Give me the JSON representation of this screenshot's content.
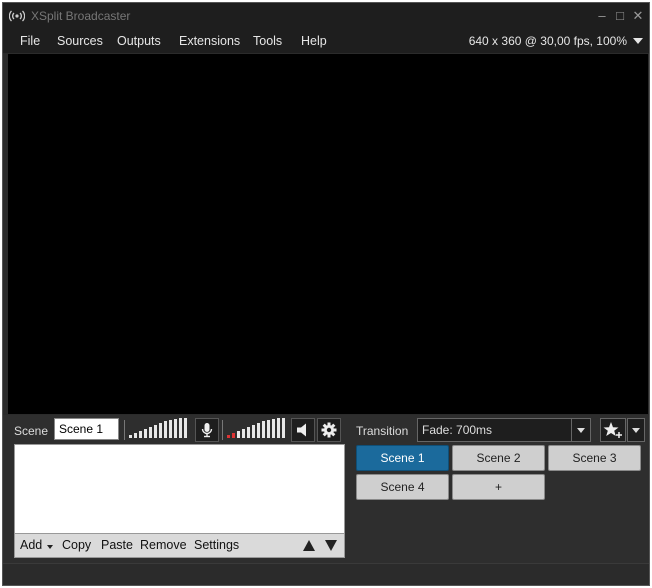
{
  "window": {
    "title": "XSplit Broadcaster",
    "minimize": "–",
    "maximize": "□",
    "close": "✕"
  },
  "menu": [
    "File",
    "Sources",
    "Outputs",
    "Extensions",
    "Tools",
    "Help"
  ],
  "resolution": "640 x 360 @ 30,00 fps, 100%",
  "scene": {
    "label": "Scene",
    "name": "Scene 1"
  },
  "audio": {
    "mic_level": 0.0,
    "speaker_level": 0.0
  },
  "sources_toolbar": {
    "add": "Add",
    "copy": "Copy",
    "paste": "Paste",
    "remove": "Remove",
    "settings": "Settings"
  },
  "transition": {
    "label": "Transition",
    "value": "Fade: 700ms"
  },
  "scenes": [
    {
      "label": "Scene 1",
      "active": true
    },
    {
      "label": "Scene 2",
      "active": false
    },
    {
      "label": "Scene 3",
      "active": false
    },
    {
      "label": "Scene 4",
      "active": false
    },
    {
      "label": "+",
      "active": false
    }
  ],
  "colors": {
    "active_scene": "#1b6a9c",
    "preview_bg": "#000000",
    "chrome": "#1e1e1e"
  },
  "icons": [
    "broadcast-icon",
    "microphone-icon",
    "speaker-icon",
    "gear-icon",
    "star-add-icon"
  ]
}
